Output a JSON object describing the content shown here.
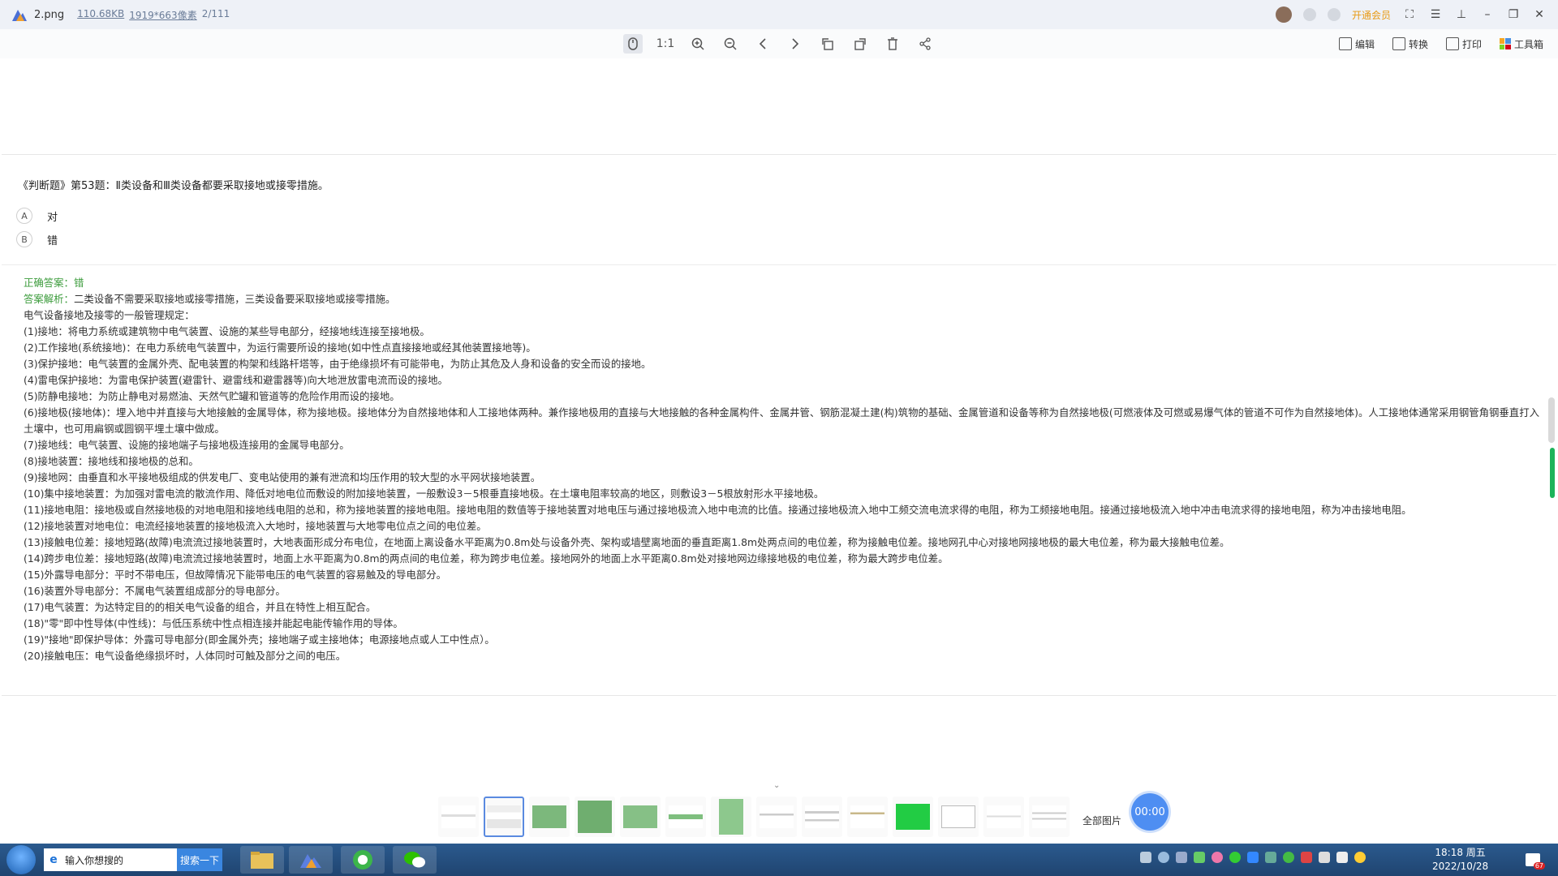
{
  "titlebar": {
    "file_name": "2.png",
    "file_size": "110.68KB",
    "resolution": "1919*663像素",
    "index": "2/111",
    "vip_label": "开通会员"
  },
  "toolbar": {
    "tools": [
      "mouse-icon",
      "actual-size-icon",
      "zoom-in-icon",
      "zoom-out-icon",
      "prev-icon",
      "next-icon",
      "rotate-left-icon",
      "rotate-right-icon",
      "delete-icon",
      "share-icon"
    ],
    "actual_size": "1:1",
    "edit_label": "编辑",
    "convert_label": "转换",
    "print_label": "打印",
    "toolbox_label": "工具箱"
  },
  "question": {
    "text": "《判断题》第53题：Ⅱ类设备和Ⅲ类设备都要采取接地或接零措施。",
    "options": [
      {
        "letter": "A",
        "text": "对"
      },
      {
        "letter": "B",
        "text": "错"
      }
    ]
  },
  "answer": {
    "correct_label": "正确答案：",
    "correct_value": "错",
    "analysis_label": "答案解析：",
    "analysis_text": "二类设备不需要采取接地或接零措施，三类设备要采取接地或接零措施。",
    "lines": [
      "电气设备接地及接零的一般管理规定：",
      "(1)接地：将电力系统或建筑物中电气装置、设施的某些导电部分，经接地线连接至接地极。",
      "(2)工作接地(系统接地)：在电力系统电气装置中，为运行需要所设的接地(如中性点直接接地或经其他装置接地等)。",
      "(3)保护接地：电气装置的金属外壳、配电装置的构架和线路杆塔等，由于绝缘损坏有可能带电，为防止其危及人身和设备的安全而设的接地。",
      "(4)雷电保护接地：为雷电保护装置(避雷针、避雷线和避雷器等)向大地泄放雷电流而设的接地。",
      "(5)防静电接地：为防止静电对易燃油、天然气贮罐和管道等的危险作用而设的接地。",
      "(6)接地极(接地体)：埋入地中并直接与大地接触的金属导体，称为接地极。接地体分为自然接地体和人工接地体两种。兼作接地极用的直接与大地接触的各种金属构件、金属井管、钢筋混凝土建(构)筑物的基础、金属管道和设备等称为自然接地极(可燃液体及可燃或易爆气体的管道不可作为自然接地体)。人工接地体通常采用钢管角钢垂直打入土壤中，也可用扁钢或圆钢平埋土壤中做成。",
      "(7)接地线：电气装置、设施的接地端子与接地极连接用的金属导电部分。",
      "(8)接地装置：接地线和接地极的总和。",
      "(9)接地网：由垂直和水平接地极组成的供发电厂、变电站使用的兼有泄流和均压作用的较大型的水平网状接地装置。",
      "(10)集中接地装置：为加强对雷电流的散流作用、降低对地电位而敷设的附加接地装置，一般敷设3－5根垂直接地极。在土壤电阻率较高的地区，则敷设3－5根放射形水平接地极。",
      "(11)接地电阻：接地极或自然接地极的对地电阻和接地线电阻的总和，称为接地装置的接地电阻。接地电阻的数值等于接地装置对地电压与通过接地极流入地中电流的比值。接通过接地极流入地中工频交流电流求得的电阻，称为工频接地电阻。接通过接地极流入地中冲击电流求得的接地电阻，称为冲击接地电阻。",
      "(12)接地装置对地电位：电流经接地装置的接地极流入大地时，接地装置与大地零电位点之间的电位差。",
      "(13)接触电位差：接地短路(故障)电流流过接地装置时，大地表面形成分布电位，在地面上离设备水平距离为0.8m处与设备外壳、架构或墙壁离地面的垂直距离1.8m处两点间的电位差，称为接触电位差。接地网孔中心对接地网接地极的最大电位差，称为最大接触电位差。",
      "(14)跨步电位差：接地短路(故障)电流流过接地装置时，地面上水平距离为0.8m的两点间的电位差，称为跨步电位差。接地网外的地面上水平距离0.8m处对接地网边缘接地极的电位差，称为最大跨步电位差。",
      "(15)外露导电部分：平时不带电压，但故障情况下能带电压的电气装置的容易触及的导电部分。",
      "(16)装置外导电部分：不属电气装置组成部分的导电部分。",
      "(17)电气装置：为达特定目的的相关电气设备的组合，并且在特性上相互配合。",
      "(18)\"零\"即中性导体(中性线)：与低压系统中性点相连接并能起电能传输作用的导体。",
      "(19)\"接地\"即保护导体：外露可导电部分(即金属外壳；接地端子或主接地体；电源接地点或人工中性点）。",
      "(20)接触电压：电气设备绝缘损坏时，人体同时可触及部分之间的电压。"
    ]
  },
  "thumbnails": {
    "all_label": "全部图片",
    "timer": "00:00"
  },
  "taskbar": {
    "search_placeholder": "输入你想搜的",
    "search_button": "搜索一下",
    "time": "18:18 周五",
    "date": "2022/10/28",
    "notify_count": "67"
  }
}
